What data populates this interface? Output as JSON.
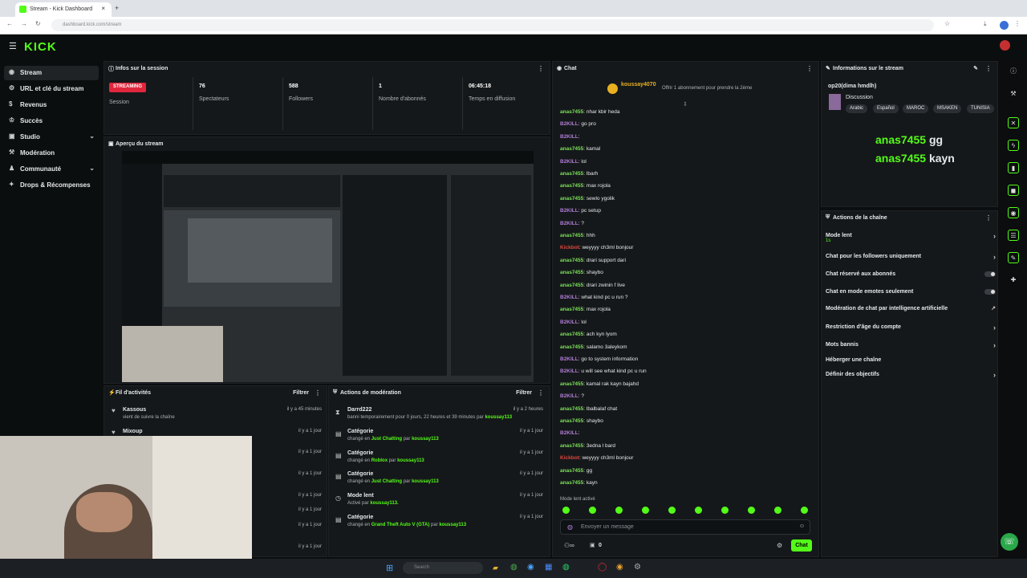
{
  "browser": {
    "tab_title": "Stream - Kick Dashboard",
    "url": "dashboard.kick.com/stream"
  },
  "header": {
    "logo": "KICK"
  },
  "sidebar": {
    "items": [
      {
        "label": "Stream",
        "icon": "broadcast-icon"
      },
      {
        "label": "URL et clé du stream",
        "icon": "gear-icon"
      },
      {
        "label": "Revenus",
        "icon": "dollar-icon"
      },
      {
        "label": "Succès",
        "icon": "trophy-icon"
      },
      {
        "label": "Studio",
        "icon": "studio-icon"
      },
      {
        "label": "Modération",
        "icon": "hammer-icon"
      },
      {
        "label": "Communauté",
        "icon": "people-icon"
      },
      {
        "label": "Drops & Récompenses",
        "icon": "gift-icon"
      }
    ]
  },
  "session": {
    "title": "Infos sur la session",
    "badge": "STREAMING",
    "badge_label": "Session",
    "stats": [
      {
        "value": "76",
        "label": "Spectateurs"
      },
      {
        "value": "588",
        "label": "Followers"
      },
      {
        "value": "1",
        "label": "Nombre d'abonnés"
      },
      {
        "value": "06:45:18",
        "label": "Temps en diffusion"
      }
    ]
  },
  "preview": {
    "title": "Aperçu du stream"
  },
  "activity": {
    "title": "Fil d'activités",
    "filter": "Filtrer",
    "items": [
      {
        "name": "Kassous",
        "desc": "vient de suivre la chaîne",
        "time": "il y a 45 minutes"
      },
      {
        "name": "Mixoup",
        "desc": "",
        "time": "il y a 1 jour"
      },
      {
        "name": "",
        "desc": "",
        "time": "il y a 1 jour"
      },
      {
        "name": "",
        "desc": "",
        "time": "il y a 1 jour"
      },
      {
        "name": "",
        "desc": "",
        "time": "il y a 1 jour"
      },
      {
        "name": "",
        "desc": "",
        "time": "il y a 1 jour"
      },
      {
        "name": "",
        "desc": "",
        "time": "il y a 1 jour"
      },
      {
        "name": "",
        "desc": "",
        "time": "il y a 1 jour"
      }
    ]
  },
  "moderation": {
    "title": "Actions de modération",
    "filter": "Filtrer",
    "items": [
      {
        "name": "Darrd222",
        "desc": "banni temporairement pour 0 jours, 22 heures et 39 minutes par",
        "by": "koussay113",
        "time": "il y a 2 heures"
      },
      {
        "name": "Catégorie",
        "desc": "changé en",
        "value": "Just Chatting",
        "by": "koussay113",
        "time": "il y a 1 jour"
      },
      {
        "name": "Catégorie",
        "desc": "changé en",
        "value": "Roblox",
        "by": "koussay113",
        "time": "il y a 1 jour"
      },
      {
        "name": "Catégorie",
        "desc": "changé en",
        "value": "Just Chatting",
        "by": "koussay113",
        "time": "il y a 1 jour"
      },
      {
        "name": "Mode lent",
        "desc": "Activé par",
        "value": "",
        "by": "koussay113.",
        "time": "il y a 1 jour"
      },
      {
        "name": "Catégorie",
        "desc": "changé en",
        "value": "Grand Theft Auto V (GTA)",
        "by": "koussay113",
        "time": "il y a 1 jour"
      }
    ]
  },
  "chat": {
    "title": "Chat",
    "pinned_user": "koussay4070",
    "pinned_text": "Offrir 1 abonnement pour prendre la 2ème",
    "messages": [
      {
        "user": "anas7455",
        "text": "nhar kbir heda",
        "color": "green"
      },
      {
        "user": "B2KILL",
        "text": "go pro",
        "color": "purple"
      },
      {
        "user": "B2KILL",
        "text": "",
        "color": "purple"
      },
      {
        "user": "anas7455",
        "text": "kamal",
        "color": "green"
      },
      {
        "user": "B2KILL",
        "text": "lol",
        "color": "purple"
      },
      {
        "user": "anas7455",
        "text": "lbarh",
        "color": "green"
      },
      {
        "user": "anas7455",
        "text": "max rojola",
        "color": "green"
      },
      {
        "user": "anas7455",
        "text": "sewlo ygolik",
        "color": "green"
      },
      {
        "user": "B2KILL",
        "text": "pc setup",
        "color": "purple"
      },
      {
        "user": "B2KILL",
        "text": "?",
        "color": "purple"
      },
      {
        "user": "anas7455",
        "text": "hhh",
        "color": "green"
      },
      {
        "user": "Kickbot",
        "text": "weyyyy ch3ml bonjour",
        "color": "red"
      },
      {
        "user": "anas7455",
        "text": "drari support dari",
        "color": "green"
      },
      {
        "user": "anas7455",
        "text": "shaybo",
        "color": "green"
      },
      {
        "user": "anas7455",
        "text": "drari zwinin f live",
        "color": "green"
      },
      {
        "user": "B2KILL",
        "text": "what kind pc u run ?",
        "color": "purple"
      },
      {
        "user": "anas7455",
        "text": "max rojola",
        "color": "green"
      },
      {
        "user": "B2KILL",
        "text": "lol",
        "color": "purple"
      },
      {
        "user": "anas7455",
        "text": "ach kyn lyom",
        "color": "green"
      },
      {
        "user": "anas7455",
        "text": "salamo 3aleykom",
        "color": "green"
      },
      {
        "user": "B2KILL",
        "text": "go to system information",
        "color": "purple"
      },
      {
        "user": "B2KILL",
        "text": "u will see what kind pc u run",
        "color": "purple"
      },
      {
        "user": "anas7455",
        "text": "kamal rak kayn bajahd",
        "color": "green"
      },
      {
        "user": "B2KILL",
        "text": "?",
        "color": "purple"
      },
      {
        "user": "anas7455",
        "text": "lbalbalaf chat",
        "color": "green"
      },
      {
        "user": "anas7455",
        "text": "shaybo",
        "color": "green"
      },
      {
        "user": "B2KILL",
        "text": "",
        "color": "purple"
      },
      {
        "user": "anas7455",
        "text": "3edna l bard",
        "color": "green"
      },
      {
        "user": "Kickbot",
        "text": "weyyyy ch3ml bonjour",
        "color": "red"
      },
      {
        "user": "anas7455",
        "text": "gg",
        "color": "green"
      },
      {
        "user": "anas7455",
        "text": "kayn",
        "color": "green"
      }
    ],
    "slow_mode": "Mode lent activé",
    "input_placeholder": "Envoyer un message",
    "count": "0",
    "send_label": "Chat"
  },
  "stream_info": {
    "title": "Informations sur le stream",
    "stream_title": "op20(dima hmdlh)",
    "category": "Discussion",
    "tags": [
      "Arabic",
      "Español",
      "MAROC",
      "MSAKEN",
      "TUNISIA"
    ],
    "overlay_lines": [
      {
        "user": "anas7455",
        "text": "gg"
      },
      {
        "user": "anas7455",
        "text": "kayn"
      }
    ]
  },
  "channel_actions": {
    "title": "Actions de la chaîne",
    "items": [
      {
        "label": "Mode lent",
        "sub": "1s",
        "control": "arrow"
      },
      {
        "label": "Chat pour les followers uniquement",
        "control": "arrow"
      },
      {
        "label": "Chat réservé aux abonnés",
        "control": "toggle"
      },
      {
        "label": "Chat en mode emotes seulement",
        "control": "toggle"
      },
      {
        "label": "Modération de chat par intelligence artificielle",
        "control": "link"
      },
      {
        "label": "Restriction d'âge du compte",
        "control": "arrow"
      },
      {
        "label": "Mots bannis",
        "control": "arrow"
      },
      {
        "label": "Héberger une chaîne",
        "control": "none"
      },
      {
        "label": "Définir des objectifs",
        "control": "arrow"
      }
    ]
  },
  "taskbar": {
    "search": "Search"
  },
  "colors": {
    "accent": "#53fc18",
    "panel": "#15181a",
    "bg": "#0b0d0e",
    "live": "#e0263c"
  }
}
